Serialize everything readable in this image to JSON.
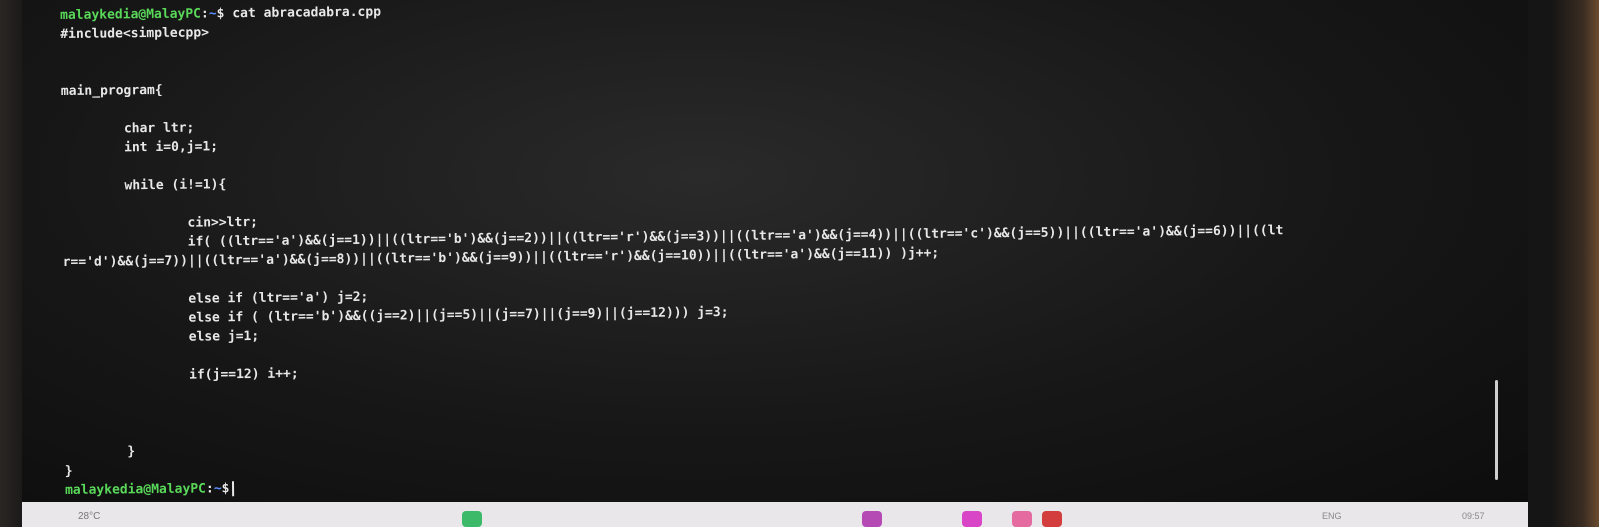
{
  "terminal": {
    "prompt": {
      "user_host": "malaykedia@MalayPC",
      "separator": ":",
      "path": "~",
      "symbol": "$"
    },
    "command": "cat abracadabra.cpp",
    "file_lines": [
      "#include<simplecpp>",
      "",
      "",
      "main_program{",
      "",
      "        char ltr;",
      "        int i=0,j=1;",
      "",
      "        while (i!=1){",
      "",
      "                cin>>ltr;",
      "                if( ((ltr=='a')&&(j==1))||((ltr=='b')&&(j==2))||((ltr=='r')&&(j==3))||((ltr=='a')&&(j==4))||((ltr=='c')&&(j==5))||((ltr=='a')&&(j==6))||((lt",
      "r=='d')&&(j==7))||((ltr=='a')&&(j==8))||((ltr=='b')&&(j==9))||((ltr=='r')&&(j==10))||((ltr=='a')&&(j==11)) )j++;",
      "",
      "                else if (ltr=='a') j=2;",
      "                else if ( (ltr=='b')&&((j==2)||(j==5)||(j==7)||(j==9)||(j==12))) j=3;",
      "                else j=1;",
      "",
      "                if(j==12) i++;",
      "",
      "",
      "",
      "        }",
      "}"
    ],
    "colors": {
      "user_host": "#59d85a",
      "path": "#5a8dff",
      "text": "#e8e8e8",
      "background": "#151515"
    }
  },
  "taskbar": {
    "weather": "28°C",
    "language": "ENG",
    "clock": "09:57"
  }
}
